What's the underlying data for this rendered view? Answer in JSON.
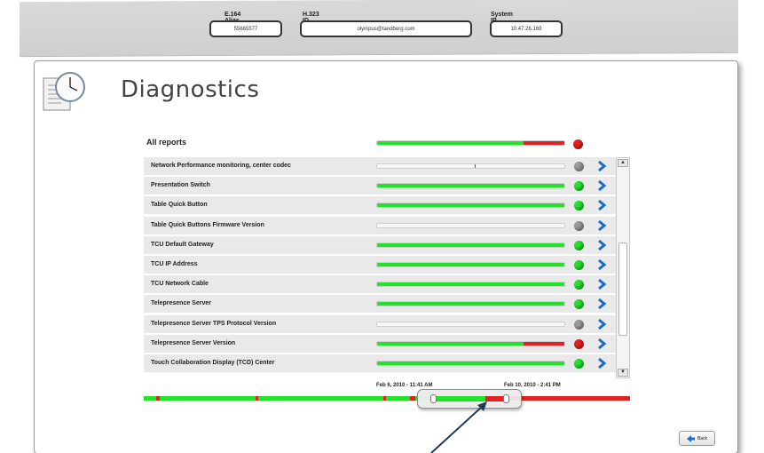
{
  "header": {
    "e164": {
      "label": "E.164 Alias",
      "value": "55665577"
    },
    "h323": {
      "label": "H.323 ID",
      "value": "olympus@tandberg.com"
    },
    "system_ip": {
      "label": "System IP",
      "value": "10.47.26.169"
    }
  },
  "page": {
    "title": "Diagnostics",
    "icon": "clock-document-icon"
  },
  "reports": {
    "all_label": "All reports",
    "all_status": {
      "green": 0.78,
      "red": 0.22,
      "status": "red"
    },
    "rows": [
      {
        "name": "Network Performance monitoring, center codec",
        "status": "grey",
        "fill": 0,
        "red": 0
      },
      {
        "name": "Presentation Switch",
        "status": "green",
        "fill": 1,
        "red": 0
      },
      {
        "name": "Table Quick Button",
        "status": "green",
        "fill": 1,
        "red": 0
      },
      {
        "name": "Table Quick Buttons Firmware Version",
        "status": "grey",
        "fill": 0,
        "red": 0
      },
      {
        "name": "TCU Default Gateway",
        "status": "green",
        "fill": 1,
        "red": 0
      },
      {
        "name": "TCU IP Address",
        "status": "green",
        "fill": 1,
        "red": 0
      },
      {
        "name": "TCU Network Cable",
        "status": "green",
        "fill": 1,
        "red": 0
      },
      {
        "name": "Telepresence Server",
        "status": "green",
        "fill": 1,
        "red": 0
      },
      {
        "name": "Telepresence Server TPS Protocol Version",
        "status": "grey",
        "fill": 0,
        "red": 0
      },
      {
        "name": "Telepresence Server Version",
        "status": "red",
        "fill": 0.78,
        "red": 0.22
      },
      {
        "name": "Touch Collaboration Display (TCD) Center",
        "status": "green",
        "fill": 1,
        "red": 0
      }
    ]
  },
  "timeline": {
    "start_label": "Feb 6, 2010 - 11:41 AM",
    "end_label": "Feb 10, 2010 - 2:41 PM"
  },
  "buttons": {
    "back": "Back"
  },
  "colors": {
    "green": "#22e22a",
    "red": "#e22222",
    "grey": "#9a9a9a",
    "arrow": "#1a6cc6"
  }
}
